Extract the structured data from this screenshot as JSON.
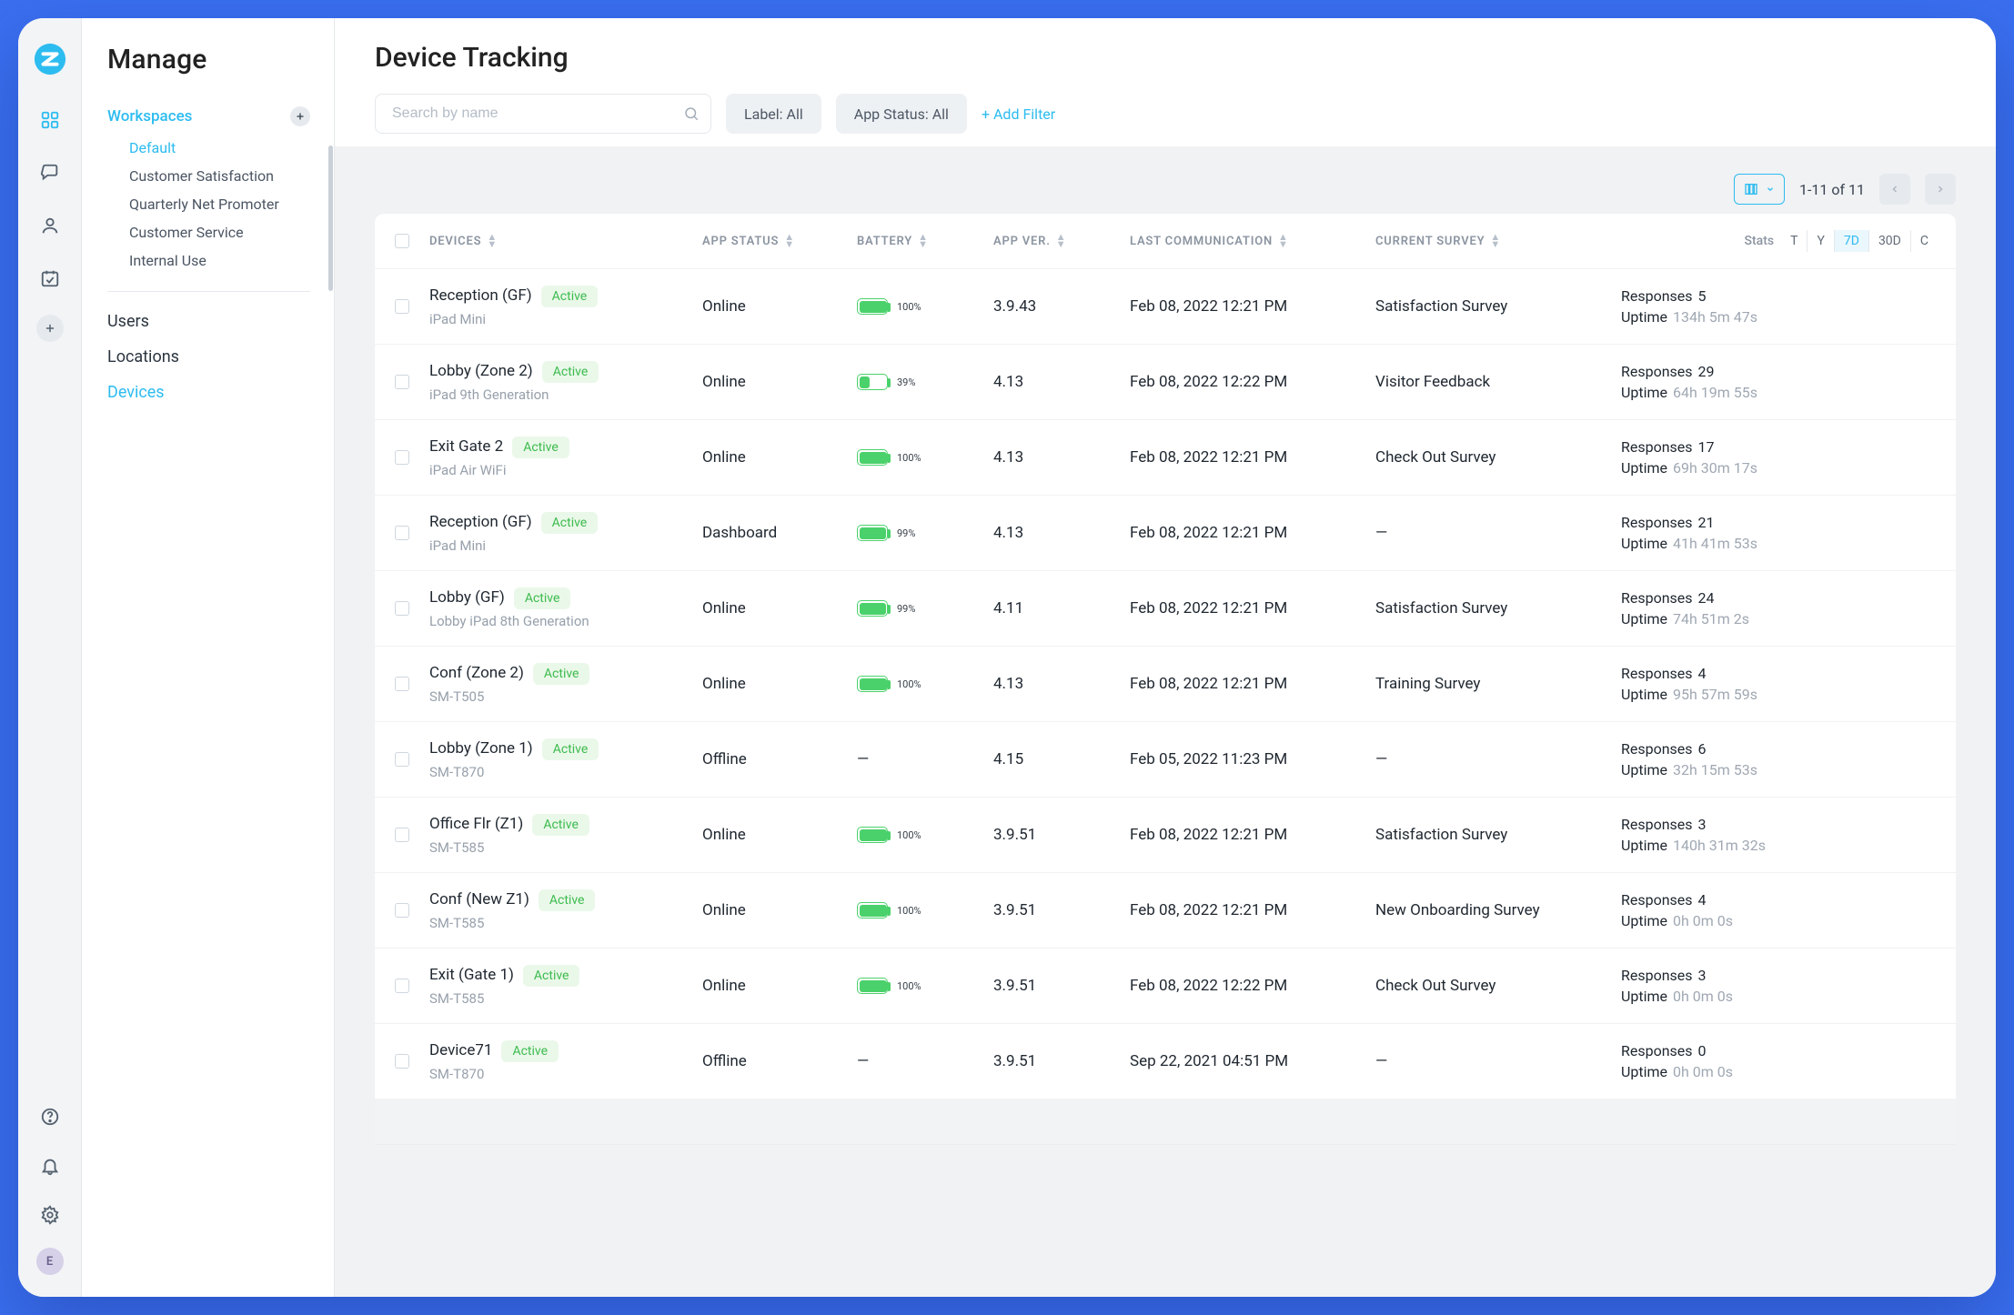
{
  "rail": {
    "avatar_initial": "E"
  },
  "side": {
    "title": "Manage",
    "workspaces_label": "Workspaces",
    "workspaces": [
      {
        "label": "Default",
        "selected": true
      },
      {
        "label": "Customer Satisfaction",
        "selected": false
      },
      {
        "label": "Quarterly Net Promoter",
        "selected": false
      },
      {
        "label": "Customer Service",
        "selected": false
      },
      {
        "label": "Internal Use",
        "selected": false
      }
    ],
    "links": [
      {
        "label": "Users",
        "selected": false
      },
      {
        "label": "Locations",
        "selected": false
      },
      {
        "label": "Devices",
        "selected": true
      }
    ]
  },
  "header": {
    "title": "Device Tracking",
    "search_placeholder": "Search by name",
    "label_filter": "Label: All",
    "appstatus_filter": "App Status: All",
    "add_filter": "+ Add Filter"
  },
  "toolbar": {
    "pagination": "1-11 of 11"
  },
  "columns": {
    "devices": "DEVICES",
    "app_status": "APP STATUS",
    "battery": "BATTERY",
    "app_ver": "APP VER.",
    "last_comm": "LAST COMMUNICATION",
    "current_survey": "CURRENT SURVEY",
    "stats_label": "Stats",
    "segments": [
      "T",
      "Y",
      "7D",
      "30D",
      "C"
    ],
    "segment_selected": "7D",
    "responses_label": "Responses",
    "uptime_label": "Uptime"
  },
  "rows": [
    {
      "name": "Reception (GF)",
      "status_pill": "Active",
      "model": "iPad Mini",
      "app_status": "Online",
      "battery_pct": 100,
      "battery_text": "100%",
      "app_ver": "3.9.43",
      "last_comm": "Feb 08, 2022 12:21 PM",
      "survey": "Satisfaction Survey",
      "responses": "5",
      "uptime": "134h 5m 47s"
    },
    {
      "name": "Lobby (Zone 2)",
      "status_pill": "Active",
      "model": "iPad 9th Generation",
      "app_status": "Online",
      "battery_pct": 39,
      "battery_text": "39%",
      "app_ver": "4.13",
      "last_comm": "Feb 08, 2022 12:22 PM",
      "survey": "Visitor Feedback",
      "responses": "29",
      "uptime": "64h 19m 55s"
    },
    {
      "name": "Exit Gate 2",
      "status_pill": "Active",
      "model": "iPad Air WiFi",
      "app_status": "Online",
      "battery_pct": 100,
      "battery_text": "100%",
      "app_ver": "4.13",
      "last_comm": "Feb 08, 2022 12:21 PM",
      "survey": "Check Out Survey",
      "responses": "17",
      "uptime": "69h 30m 17s"
    },
    {
      "name": "Reception (GF)",
      "status_pill": "Active",
      "model": "iPad Mini",
      "app_status": "Dashboard",
      "battery_pct": 99,
      "battery_text": "99%",
      "app_ver": "4.13",
      "last_comm": "Feb 08, 2022 12:21 PM",
      "survey": "—",
      "responses": "21",
      "uptime": "41h 41m 53s"
    },
    {
      "name": "Lobby (GF)",
      "status_pill": "Active",
      "model": "Lobby iPad 8th Generation",
      "app_status": "Online",
      "battery_pct": 99,
      "battery_text": "99%",
      "app_ver": "4.11",
      "last_comm": "Feb 08, 2022 12:21 PM",
      "survey": "Satisfaction Survey",
      "responses": "24",
      "uptime": "74h 51m 2s"
    },
    {
      "name": "Conf (Zone 2)",
      "status_pill": "Active",
      "model": "SM-T505",
      "app_status": "Online",
      "battery_pct": 100,
      "battery_text": "100%",
      "app_ver": "4.13",
      "last_comm": "Feb 08, 2022 12:21 PM",
      "survey": "Training Survey",
      "responses": "4",
      "uptime": "95h 57m 59s"
    },
    {
      "name": "Lobby (Zone 1)",
      "status_pill": "Active",
      "model": "SM-T870",
      "app_status": "Offline",
      "battery_pct": null,
      "battery_text": "—",
      "app_ver": "4.15",
      "last_comm": "Feb 05, 2022 11:23 PM",
      "survey": "—",
      "responses": "6",
      "uptime": "32h 15m 53s"
    },
    {
      "name": "Office Flr (Z1)",
      "status_pill": "Active",
      "model": "SM-T585",
      "app_status": "Online",
      "battery_pct": 100,
      "battery_text": "100%",
      "app_ver": "3.9.51",
      "last_comm": "Feb 08, 2022 12:21 PM",
      "survey": "Satisfaction Survey",
      "responses": "3",
      "uptime": "140h 31m 32s"
    },
    {
      "name": "Conf (New Z1)",
      "status_pill": "Active",
      "model": "SM-T585",
      "app_status": "Online",
      "battery_pct": 100,
      "battery_text": "100%",
      "app_ver": "3.9.51",
      "last_comm": "Feb 08, 2022 12:21 PM",
      "survey": "New Onboarding Survey",
      "responses": "4",
      "uptime": "0h 0m 0s"
    },
    {
      "name": "Exit (Gate 1)",
      "status_pill": "Active",
      "model": "SM-T585",
      "app_status": "Online",
      "battery_pct": 100,
      "battery_text": "100%",
      "app_ver": "3.9.51",
      "last_comm": "Feb 08, 2022 12:22 PM",
      "survey": "Check Out Survey",
      "responses": "3",
      "uptime": "0h 0m 0s"
    },
    {
      "name": "Device71",
      "status_pill": "Active",
      "model": "SM-T870",
      "app_status": "Offline",
      "battery_pct": null,
      "battery_text": "—",
      "app_ver": "3.9.51",
      "last_comm": "Sep 22, 2021 04:51 PM",
      "survey": "—",
      "responses": "0",
      "uptime": "0h 0m 0s"
    }
  ]
}
